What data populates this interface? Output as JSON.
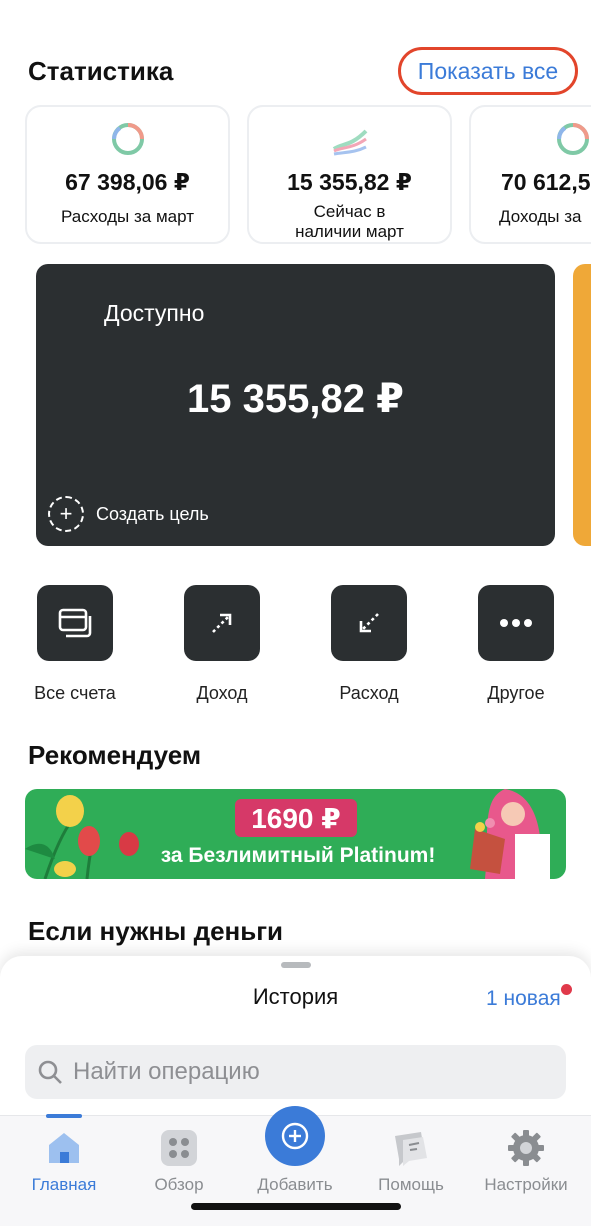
{
  "stats": {
    "title": "Статистика",
    "show_all": "Показать все",
    "cards": [
      {
        "amount": "67 398,06 ₽",
        "label": "Расходы за март"
      },
      {
        "amount": "15 355,82 ₽",
        "label_line1": "Сейчас в",
        "label_line2": "наличии март"
      },
      {
        "amount": "70 612,5",
        "label": "Доходы за"
      }
    ]
  },
  "goal": {
    "available_label": "Доступно",
    "balance": "15 355,82 ₽",
    "create_goal": "Создать цель",
    "create_goal_icon": "+"
  },
  "actions": [
    {
      "label": "Все счета",
      "icon": "cards-icon"
    },
    {
      "label": "Доход",
      "icon": "arrow-up-right-icon"
    },
    {
      "label": "Расход",
      "icon": "arrow-down-left-icon"
    },
    {
      "label": "Другое",
      "icon": "more-icon"
    }
  ],
  "recommend": {
    "title": "Рекомендуем",
    "banner_price": "1690 ₽",
    "banner_caption": "за Безлимитный Platinum!",
    "banner_color": "#2fad57"
  },
  "money_section": {
    "title": "Если нужны деньги"
  },
  "history": {
    "title": "История",
    "new_label": "1 новая",
    "search_placeholder": "Найти операцию"
  },
  "tabbar": {
    "tabs": [
      {
        "label": "Главная",
        "icon": "home-icon",
        "active": true
      },
      {
        "label": "Обзор",
        "icon": "grid-icon"
      },
      {
        "label": "Добавить",
        "icon": "plus-icon"
      },
      {
        "label": "Помощь",
        "icon": "chat-icon"
      },
      {
        "label": "Настройки",
        "icon": "gear-icon"
      }
    ]
  },
  "colors": {
    "accent": "#3b7bd8",
    "dark_card": "#2b2f31",
    "highlight_ring": "#e2452b"
  }
}
